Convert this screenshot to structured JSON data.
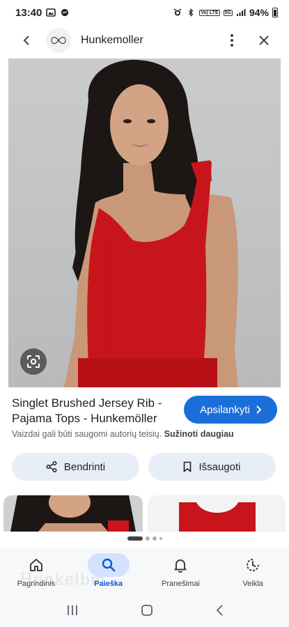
{
  "status_bar": {
    "time": "13:40",
    "battery_percent": "94%",
    "network_tag": "5G",
    "lte_tag": "Vo) LTE"
  },
  "app_bar": {
    "site_name": "Hunkemoller"
  },
  "result": {
    "title": "Singlet Brushed Jersey Rib - Pajama Tops - Hunkemöller",
    "visit_label": "Apsilankyti",
    "copyright_text": "Vaizdai gali būti saugomi autorių teisių.",
    "learn_more": "Sužinoti daugiau",
    "share_label": "Bendrinti",
    "save_label": "Išsaugoti"
  },
  "bottom_nav": {
    "items": [
      {
        "label": "Pagrindinis",
        "icon": "home-icon"
      },
      {
        "label": "Paieška",
        "icon": "search-icon",
        "active": true
      },
      {
        "label": "Pranešimai",
        "icon": "bell-icon"
      },
      {
        "label": "Veikla",
        "icon": "activity-icon"
      }
    ]
  },
  "watermark": "Hunkelbm",
  "colors": {
    "accent": "#1a6fd8",
    "pill_bg": "#e8eef7",
    "active_nav": "#d3e3fd",
    "top_red": "#c8151b"
  }
}
